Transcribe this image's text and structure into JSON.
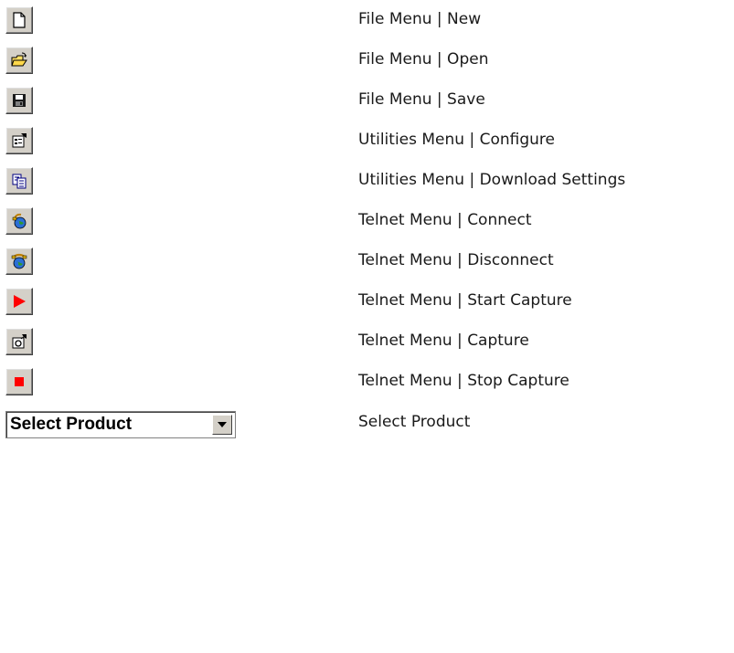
{
  "items": [
    {
      "icon": "new-file-icon",
      "label": "File Menu | New"
    },
    {
      "icon": "open-folder-icon",
      "label": "File Menu | Open"
    },
    {
      "icon": "save-disk-icon",
      "label": "File Menu | Save"
    },
    {
      "icon": "configure-icon",
      "label": "Utilities Menu | Configure"
    },
    {
      "icon": "download-settings-icon",
      "label": "Utilities Menu | Download Settings"
    },
    {
      "icon": "connect-globe-icon",
      "label": "Telnet Menu | Connect"
    },
    {
      "icon": "disconnect-globe-icon",
      "label": "Telnet Menu | Disconnect"
    },
    {
      "icon": "start-capture-icon",
      "label": "Telnet Menu | Start Capture"
    },
    {
      "icon": "capture-icon",
      "label": "Telnet Menu | Capture"
    },
    {
      "icon": "stop-capture-icon",
      "label": "Telnet Menu | Stop Capture"
    }
  ],
  "select": {
    "value": "Select Product",
    "label": "Select Product",
    "icon": "chevron-down-icon"
  }
}
